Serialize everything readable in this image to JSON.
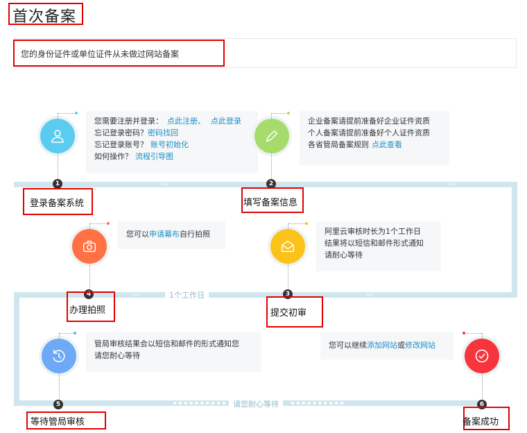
{
  "page_title": "首次备案",
  "notice": "您的身份证件或单位证件从未做过网站备案",
  "track_labels": {
    "one_day": "1个工作日",
    "wait": "请您耐心等待"
  },
  "steps": [
    {
      "num": "1",
      "label": "登录备案系统"
    },
    {
      "num": "2",
      "label": "填写备案信息"
    },
    {
      "num": "3",
      "label": "提交初审"
    },
    {
      "num": "4",
      "label": "办理拍照"
    },
    {
      "num": "5",
      "label": "等待管局审核"
    },
    {
      "num": "6",
      "label": "备案成功"
    }
  ],
  "info1": {
    "line1_text": "您需要注册并登录：",
    "line1_link1": "点此注册、",
    "line1_link2": "点此登录",
    "line2_text": "忘记登录密码？",
    "line2_link": "密码找回",
    "line3_text": "忘记登录账号？",
    "line3_link": "账号初始化",
    "line4_text": "如何操作？",
    "line4_link": "流程引导图"
  },
  "info2": {
    "line1": "企业备案请提前准备好企业证件资质",
    "line2": "个人备案请提前准备好个人证件资质",
    "line3_text": "各省管局备案规则",
    "line3_link": "点此查看"
  },
  "info3": {
    "text_before": "您可以",
    "link": "申请幕布",
    "text_after": "自行拍照"
  },
  "info4": {
    "line1": "阿里云审核时长为1个工作日",
    "line2": "结果将以短信和邮件形式通知",
    "line3": "请耐心等待"
  },
  "info5": {
    "line1": "管局审核结果会以短信和邮件的形式通知您",
    "line2": "请您耐心等待"
  },
  "info6": {
    "text_before": "您可以继续",
    "link1": "添加网站",
    "text_mid": "或",
    "link2": "修改网站"
  },
  "colors": {
    "step1": "#5ccbf0",
    "step2": "#a7dc6d",
    "step3": "#fbc21a",
    "step4": "#ff7043",
    "step5": "#6ea9f5",
    "step6": "#f7353d",
    "track": "#cfe6ee",
    "link": "#1a8fc9",
    "highlight_border": "#e00000"
  },
  "icons": {
    "step1": "user-icon",
    "step2": "pencil-icon",
    "step3": "envelope-icon",
    "step4": "camera-icon",
    "step5": "clock-icon",
    "step6": "check-icon"
  }
}
